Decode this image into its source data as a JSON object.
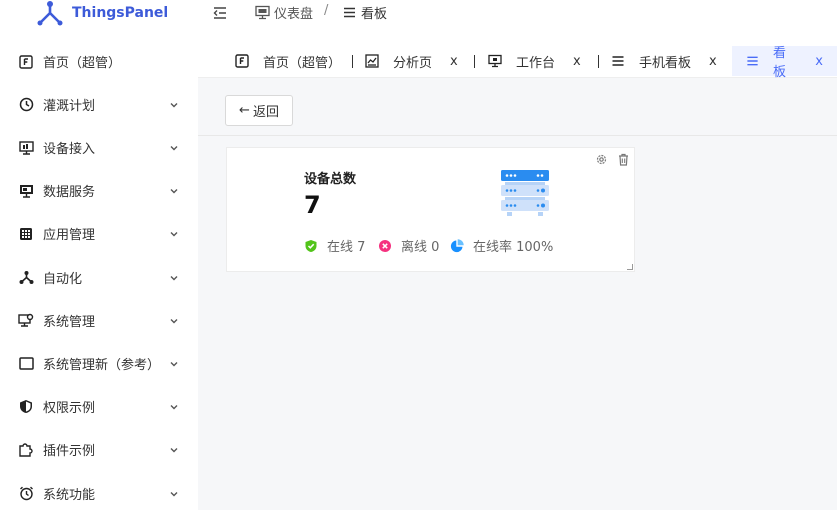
{
  "app": {
    "name": "ThingsPanel"
  },
  "sidebar": {
    "items": [
      {
        "label": "首页（超管）",
        "icon": "home-f-icon",
        "expandable": false
      },
      {
        "label": "灌溉计划",
        "icon": "clock-icon",
        "expandable": true
      },
      {
        "label": "设备接入",
        "icon": "device-monitor-icon",
        "expandable": true
      },
      {
        "label": "数据服务",
        "icon": "data-screen-icon",
        "expandable": true
      },
      {
        "label": "应用管理",
        "icon": "apps-grid-icon",
        "expandable": true
      },
      {
        "label": "自动化",
        "icon": "automation-icon",
        "expandable": true
      },
      {
        "label": "系统管理",
        "icon": "system-settings-icon",
        "expandable": true
      },
      {
        "label": "系统管理新（参考）",
        "icon": "window-icon",
        "expandable": true
      },
      {
        "label": "权限示例",
        "icon": "shield-icon",
        "expandable": true
      },
      {
        "label": "插件示例",
        "icon": "puzzle-icon",
        "expandable": true
      },
      {
        "label": "系统功能",
        "icon": "alarm-clock-icon",
        "expandable": true
      }
    ]
  },
  "breadcrumb": {
    "items": [
      {
        "label": "仪表盘",
        "icon": "dashboard-monitor-icon"
      },
      {
        "label": "看板",
        "icon": "menu-lines-icon"
      }
    ],
    "separator": "/"
  },
  "tabs": [
    {
      "label": "首页（超管）",
      "icon": "home-f-icon",
      "closable": false,
      "active": false
    },
    {
      "label": "分析页",
      "icon": "analysis-icon",
      "closable": true,
      "active": false
    },
    {
      "label": "工作台",
      "icon": "monitor-icon",
      "closable": true,
      "active": false
    },
    {
      "label": "手机看板",
      "icon": "menu-lines-icon",
      "closable": true,
      "active": false
    },
    {
      "label": "看板",
      "icon": "menu-lines-icon",
      "closable": true,
      "active": true
    }
  ],
  "tab_close_glyph": "x",
  "back_button": {
    "label": "返回",
    "arrow": "←"
  },
  "card": {
    "title": "设备总数",
    "value": "7",
    "stats": [
      {
        "label": "在线 7",
        "icon": "online-check-icon",
        "color": "#52c41a"
      },
      {
        "label": "离线 0",
        "icon": "offline-x-icon",
        "color": "#f5317f"
      },
      {
        "label": "在线率 100%",
        "icon": "pie-chart-icon",
        "color": "#1890ff"
      }
    ]
  },
  "colors": {
    "brand": "#3d5bd9",
    "accent": "#4a6cf7",
    "active_tab_bg": "#eef2ff",
    "background": "#f6f7f9"
  }
}
